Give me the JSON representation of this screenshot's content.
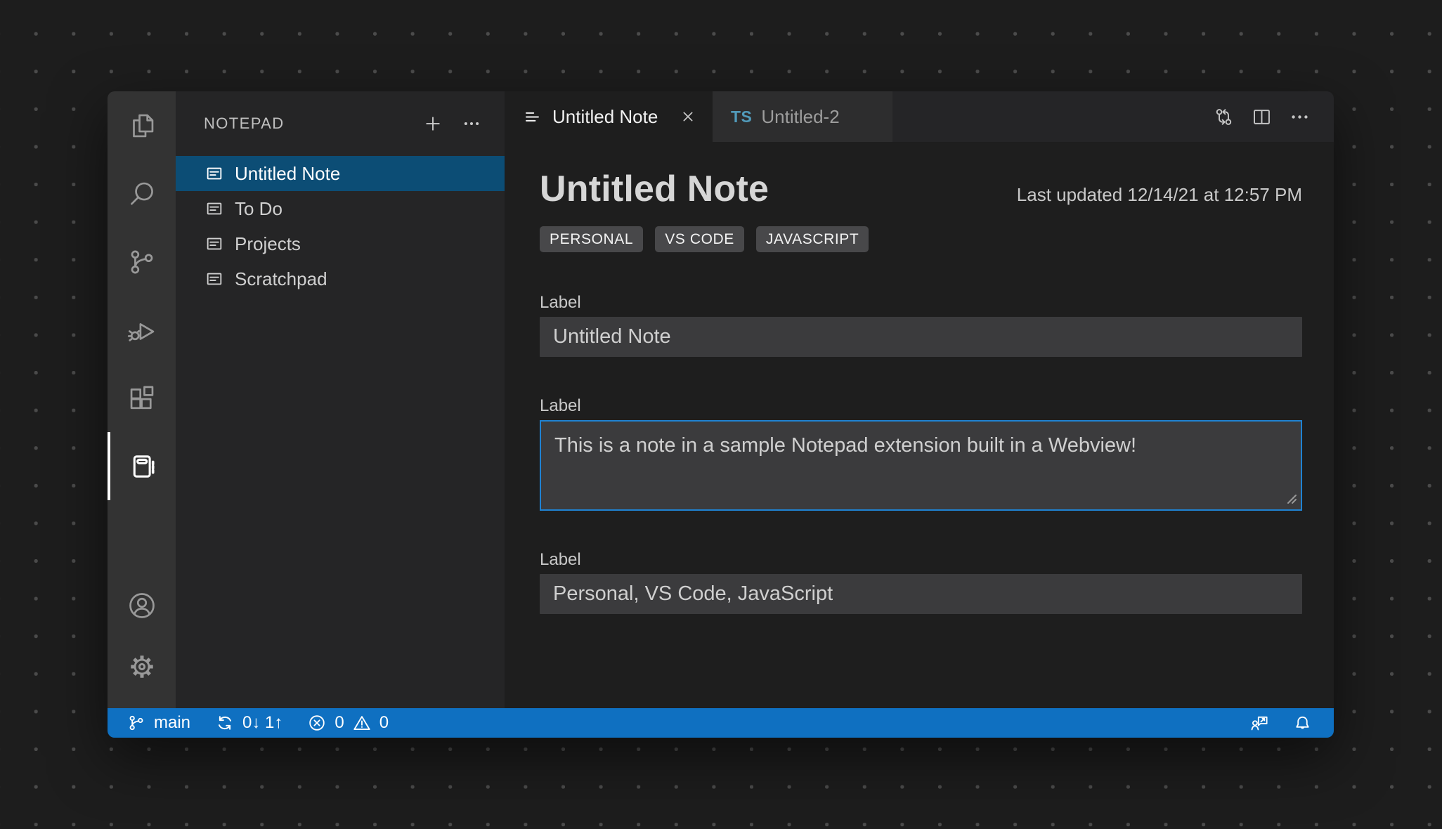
{
  "colors": {
    "selection_blue": "#0c4d75",
    "status_bar_blue": "#0f70c1",
    "focus_border_blue": "#1f82d2",
    "badge_gray": "#48484a",
    "ts_icon_blue": "#519aba"
  },
  "sidebar": {
    "title": "NOTEPAD",
    "notes": [
      {
        "label": "Untitled Note",
        "selected": true
      },
      {
        "label": "To Do",
        "selected": false
      },
      {
        "label": "Projects",
        "selected": false
      },
      {
        "label": "Scratchpad",
        "selected": false
      }
    ]
  },
  "tabs": {
    "active": {
      "label": "Untitled Note"
    },
    "inactive": {
      "badge": "TS",
      "label": "Untitled-2"
    }
  },
  "note": {
    "title": "Untitled Note",
    "last_updated": "Last updated 12/14/21 at 12:57 PM",
    "tags": [
      "PERSONAL",
      "VS CODE",
      "JAVASCRIPT"
    ],
    "fields": [
      {
        "label": "Label",
        "value": "Untitled Note"
      },
      {
        "label": "Label",
        "value": "This is a note in a sample Notepad extension built in a Webview!"
      },
      {
        "label": "Label",
        "value": "Personal, VS Code, JavaScript"
      }
    ]
  },
  "status_bar": {
    "branch": "main",
    "sync": "0↓ 1↑",
    "error_count": "0",
    "warning_count": "0"
  }
}
